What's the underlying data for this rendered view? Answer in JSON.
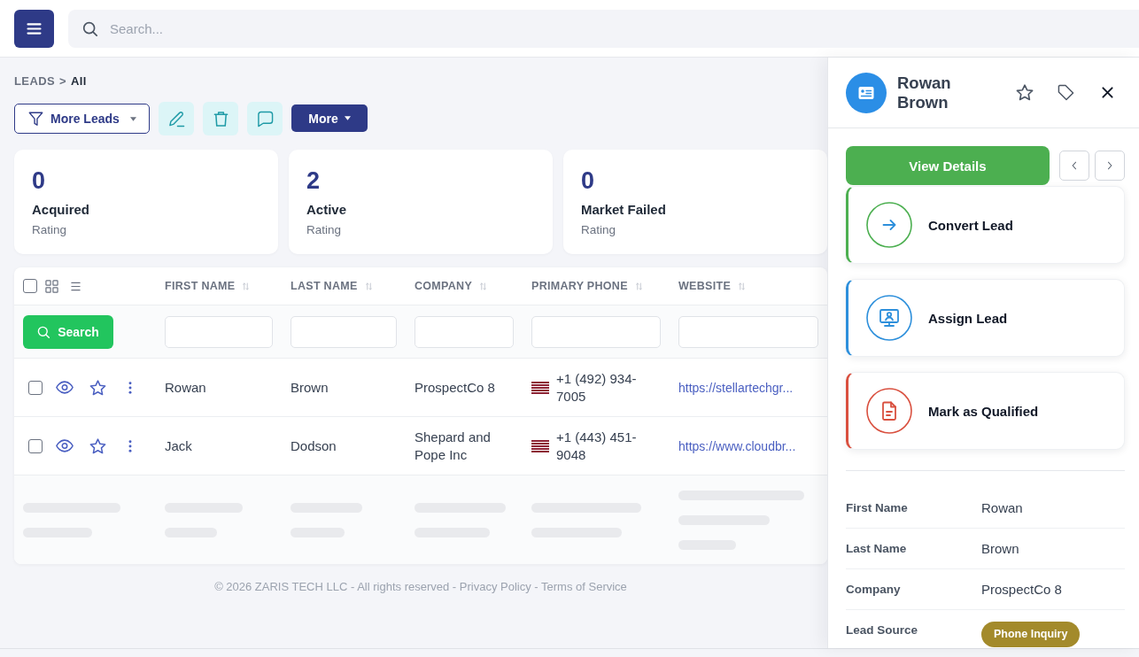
{
  "top_bar": {
    "search": {
      "placeholder": "Search..."
    }
  },
  "breadcrumb": {
    "items": [
      "LEADS",
      "All"
    ],
    "separator": ">"
  },
  "toolbar": {
    "filter_button": "More Leads",
    "more_button": "More"
  },
  "stats": [
    {
      "value": "0",
      "label": "Acquired",
      "caption": "Rating"
    },
    {
      "value": "2",
      "label": "Active",
      "caption": "Rating"
    },
    {
      "value": "0",
      "label": "Market Failed",
      "caption": "Rating"
    }
  ],
  "table": {
    "select_all": {
      "checked": false
    },
    "columns": [
      {
        "label": "FIRST NAME",
        "kind": "text"
      },
      {
        "label": "LAST NAME",
        "kind": "text"
      },
      {
        "label": "COMPANY",
        "kind": "text"
      },
      {
        "label": "PRIMARY PHONE",
        "kind": "phone"
      },
      {
        "label": "WEBSITE",
        "kind": "link"
      }
    ],
    "search_button": "Search",
    "rows": [
      {
        "checked": false,
        "starred": false,
        "cells": [
          "Rowan",
          "Brown",
          "ProspectCo 8",
          "+1 (492) 934-7005",
          "https://stellartechgr..."
        ]
      },
      {
        "checked": false,
        "starred": false,
        "cells": [
          "Jack",
          "Dodson",
          "Shepard and Pope Inc",
          "+1 (443) 451-9048",
          "https://www.cloudbr..."
        ]
      }
    ],
    "loading": true
  },
  "footer": {
    "text": "© 2026 ZARIS TECH LLC - All rights reserved",
    "separator": "-",
    "links": [
      "Privacy Policy",
      "Terms of Service"
    ]
  },
  "panel": {
    "title": "Rowan Brown",
    "starred": false,
    "primary_button": "View Details",
    "actions": [
      {
        "label": "Convert Lead",
        "color": "#4caf50"
      },
      {
        "label": "Assign Lead",
        "color": "#2d8fdb"
      },
      {
        "label": "Mark as Qualified",
        "color": "#d9503f"
      }
    ],
    "details": [
      {
        "label": "First Name",
        "value": "Rowan",
        "kind": "text"
      },
      {
        "label": "Last Name",
        "value": "Brown",
        "kind": "text"
      },
      {
        "label": "Company",
        "value": "ProspectCo 8",
        "kind": "text"
      },
      {
        "label": "Lead Source",
        "value": "Phone Inquiry",
        "kind": "badge"
      }
    ]
  }
}
